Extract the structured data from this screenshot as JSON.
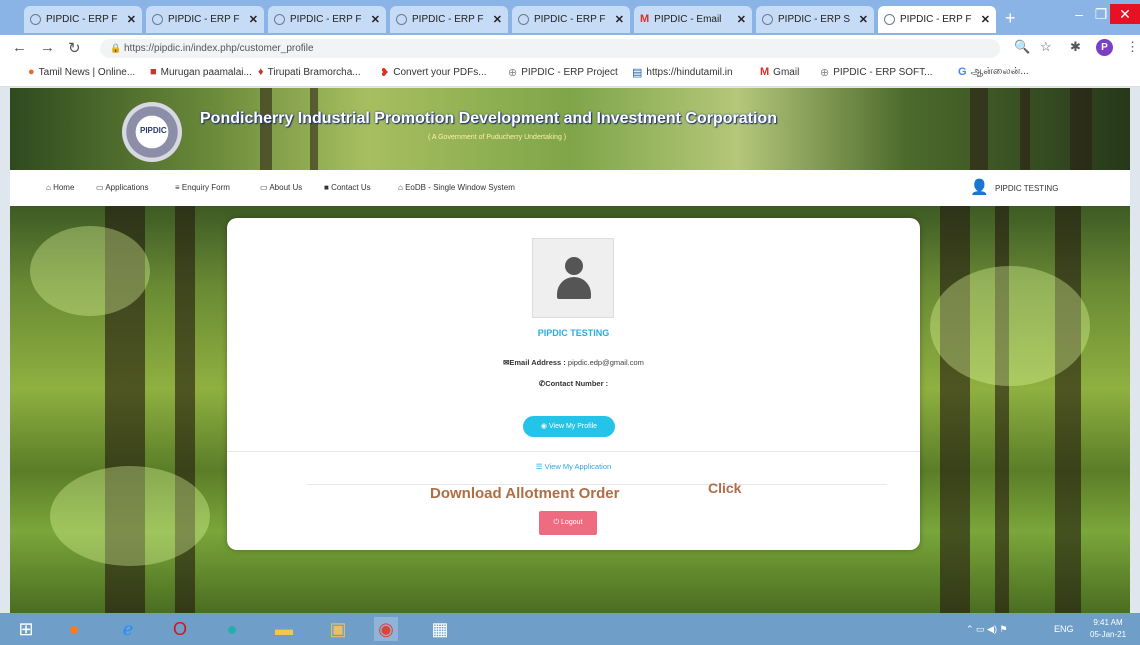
{
  "browser": {
    "tabs": [
      {
        "label": "PIPDIC - ERP F",
        "icon": "globe-icon"
      },
      {
        "label": "PIPDIC - ERP F",
        "icon": "globe-icon"
      },
      {
        "label": "PIPDIC - ERP F",
        "icon": "globe-icon"
      },
      {
        "label": "PIPDIC - ERP F",
        "icon": "globe-icon"
      },
      {
        "label": "PIPDIC - ERP F",
        "icon": "globe-icon"
      },
      {
        "label": "PIPDIC - Email",
        "icon": "gmail-icon"
      },
      {
        "label": "PIPDIC - ERP S",
        "icon": "globe-icon"
      },
      {
        "label": "PIPDIC - ERP F",
        "icon": "globe-icon"
      }
    ],
    "url": "https://pipdic.in/index.php/customer_profile",
    "profile_initial": "P",
    "bookmarks": [
      {
        "label": "Tamil News | Online...",
        "icon": "news-icon"
      },
      {
        "label": "Murugan paamalai...",
        "icon": "bookmark-icon"
      },
      {
        "label": "Tirupati Bramorcha...",
        "icon": "bookmark-icon"
      },
      {
        "label": "Convert your PDFs...",
        "icon": "pdf-icon"
      },
      {
        "label": "PIPDIC - ERP Project",
        "icon": "globe-icon"
      },
      {
        "label": "https://hindutamil.in",
        "icon": "news-icon"
      },
      {
        "label": "Gmail",
        "icon": "gmail-icon"
      },
      {
        "label": "PIPDIC - ERP SOFT...",
        "icon": "globe-icon"
      },
      {
        "label": "ஆன்லைன்...",
        "icon": "google-icon"
      }
    ]
  },
  "site": {
    "title": "Pondicherry Industrial Promotion Development and Investment Corporation",
    "subtitle": "( A Government of Puducherry Undertaking )",
    "logo_text": "PIPDIC"
  },
  "nav": {
    "items": [
      {
        "label": "Home",
        "icon": "home-icon"
      },
      {
        "label": "Applications",
        "icon": "monitor-icon"
      },
      {
        "label": "Enquiry Form",
        "icon": "list-icon"
      },
      {
        "label": "About Us",
        "icon": "chat-icon"
      },
      {
        "label": "Contact Us",
        "icon": "book-icon"
      },
      {
        "label": "EoDB - Single Window System",
        "icon": "home-icon"
      }
    ],
    "user": "PIPDIC TESTING"
  },
  "profile": {
    "name": "PIPDIC TESTING",
    "email_label": "Email Address :",
    "email_value": "pipdic.edp@gmail.com",
    "contact_label": "Contact Number :",
    "contact_value": "",
    "view_profile": "View My Profile",
    "view_application": "View My Application",
    "download_allotment": "Download Allotment Order",
    "click_note": "Click",
    "logout": "Logout"
  },
  "taskbar": {
    "lang": "ENG",
    "time": "9:41 AM",
    "date": "05-Jan-21"
  }
}
